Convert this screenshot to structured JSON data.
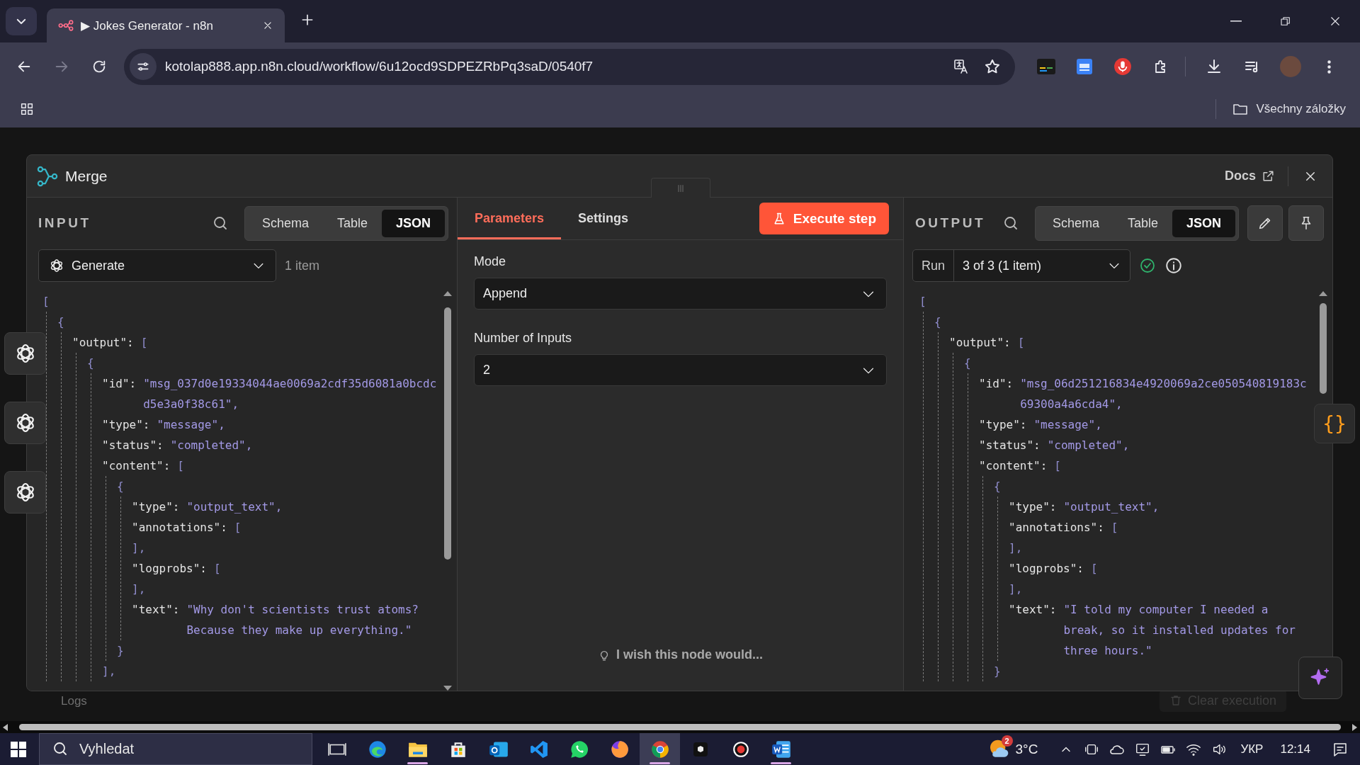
{
  "browser": {
    "tabs": [
      {
        "title": "▶ Jokes Generator - n8n",
        "selected": true
      }
    ],
    "url": "kotolap888.app.n8n.cloud/workflow/6u12ocd9SDPEZRbPq3saD/0540f7",
    "bookmarks_label": "Všechny záložky"
  },
  "canvas": {
    "logs_label": "Logs",
    "clear_button": "Clear execution",
    "code_button": "{}"
  },
  "modal": {
    "title": "Merge",
    "docs_link": "Docs",
    "input": {
      "heading": "INPUT",
      "view_tabs": [
        {
          "label": "Schema",
          "selected": false
        },
        {
          "label": "Table",
          "selected": false
        },
        {
          "label": "JSON",
          "selected": true
        }
      ],
      "source": "Generate",
      "item_count": "1 item",
      "json": [
        {
          "value": "[",
          "children": [
            {
              "value": "{",
              "children": [
                {
                  "key": "\"output\":",
                  "value": "[",
                  "children": [
                    {
                      "value": "{",
                      "children": [
                        {
                          "key": "\"id\":",
                          "value": "\"msg_037d0e19334044ae0069a2cdf35d6081a0bcdcd5e3a0f38c61\","
                        },
                        {
                          "key": "\"type\":",
                          "value": "\"message\","
                        },
                        {
                          "key": "\"status\":",
                          "value": "\"completed\","
                        },
                        {
                          "key": "\"content\":",
                          "value": "[",
                          "children": [
                            {
                              "value": "{",
                              "children": [
                                {
                                  "key": "\"type\":",
                                  "value": "\"output_text\","
                                },
                                {
                                  "key": "\"annotations\":",
                                  "value": "[",
                                  "close": "],"
                                },
                                {
                                  "key": "\"logprobs\":",
                                  "value": "[",
                                  "close": "],"
                                },
                                {
                                  "key": "\"text\":",
                                  "value": "\"Why don't scientists trust atoms? Because they make up everything.\""
                                }
                              ],
                              "close": "}"
                            }
                          ],
                          "close": "],"
                        }
                      ]
                    }
                  ]
                }
              ]
            }
          ]
        }
      ]
    },
    "parameters": {
      "tabs": [
        {
          "label": "Parameters",
          "selected": true
        },
        {
          "label": "Settings",
          "selected": false
        }
      ],
      "execute_button": "Execute step",
      "fields": [
        {
          "label": "Mode",
          "value": "Append"
        },
        {
          "label": "Number of Inputs",
          "value": "2"
        }
      ],
      "feedback": "I wish this node would..."
    },
    "output": {
      "heading": "OUTPUT",
      "view_tabs": [
        {
          "label": "Schema",
          "selected": false
        },
        {
          "label": "Table",
          "selected": false
        },
        {
          "label": "JSON",
          "selected": true
        }
      ],
      "run_label": "Run",
      "run_select": "3 of 3 (1 item)",
      "json": [
        {
          "value": "[",
          "children": [
            {
              "value": "{",
              "children": [
                {
                  "key": "\"output\":",
                  "value": "[",
                  "children": [
                    {
                      "value": "{",
                      "children": [
                        {
                          "key": "\"id\":",
                          "value": "\"msg_06d251216834e4920069a2ce050540819183c69300a4a6cda4\","
                        },
                        {
                          "key": "\"type\":",
                          "value": "\"message\","
                        },
                        {
                          "key": "\"status\":",
                          "value": "\"completed\","
                        },
                        {
                          "key": "\"content\":",
                          "value": "[",
                          "children": [
                            {
                              "value": "{",
                              "children": [
                                {
                                  "key": "\"type\":",
                                  "value": "\"output_text\","
                                },
                                {
                                  "key": "\"annotations\":",
                                  "value": "[",
                                  "close": "],"
                                },
                                {
                                  "key": "\"logprobs\":",
                                  "value": "[",
                                  "close": "],"
                                },
                                {
                                  "key": "\"text\":",
                                  "value": "\"I told my computer I needed a break, so it installed updates for three hours.\""
                                }
                              ],
                              "close": "}"
                            }
                          ]
                        }
                      ]
                    }
                  ]
                }
              ]
            }
          ]
        }
      ]
    }
  },
  "taskbar": {
    "search_placeholder": "Vyhledat",
    "apps": [
      {
        "kind": "taskview",
        "running": false,
        "selected": false
      },
      {
        "kind": "edge",
        "running": false,
        "selected": false
      },
      {
        "kind": "explorer",
        "running": true,
        "selected": false
      },
      {
        "kind": "store",
        "running": false,
        "selected": false
      },
      {
        "kind": "outlook",
        "running": false,
        "selected": false
      },
      {
        "kind": "vscode",
        "running": false,
        "selected": false
      },
      {
        "kind": "whatsapp",
        "running": false,
        "selected": false
      },
      {
        "kind": "firefox",
        "running": false,
        "selected": false
      },
      {
        "kind": "chrome",
        "running": true,
        "selected": true
      },
      {
        "kind": "cube",
        "running": false,
        "selected": false
      },
      {
        "kind": "recorder",
        "running": false,
        "selected": false
      },
      {
        "kind": "word",
        "running": true,
        "selected": false
      }
    ],
    "weather_badge": "2",
    "temperature": "3°C",
    "language": "УКР",
    "time": "12:14"
  }
}
